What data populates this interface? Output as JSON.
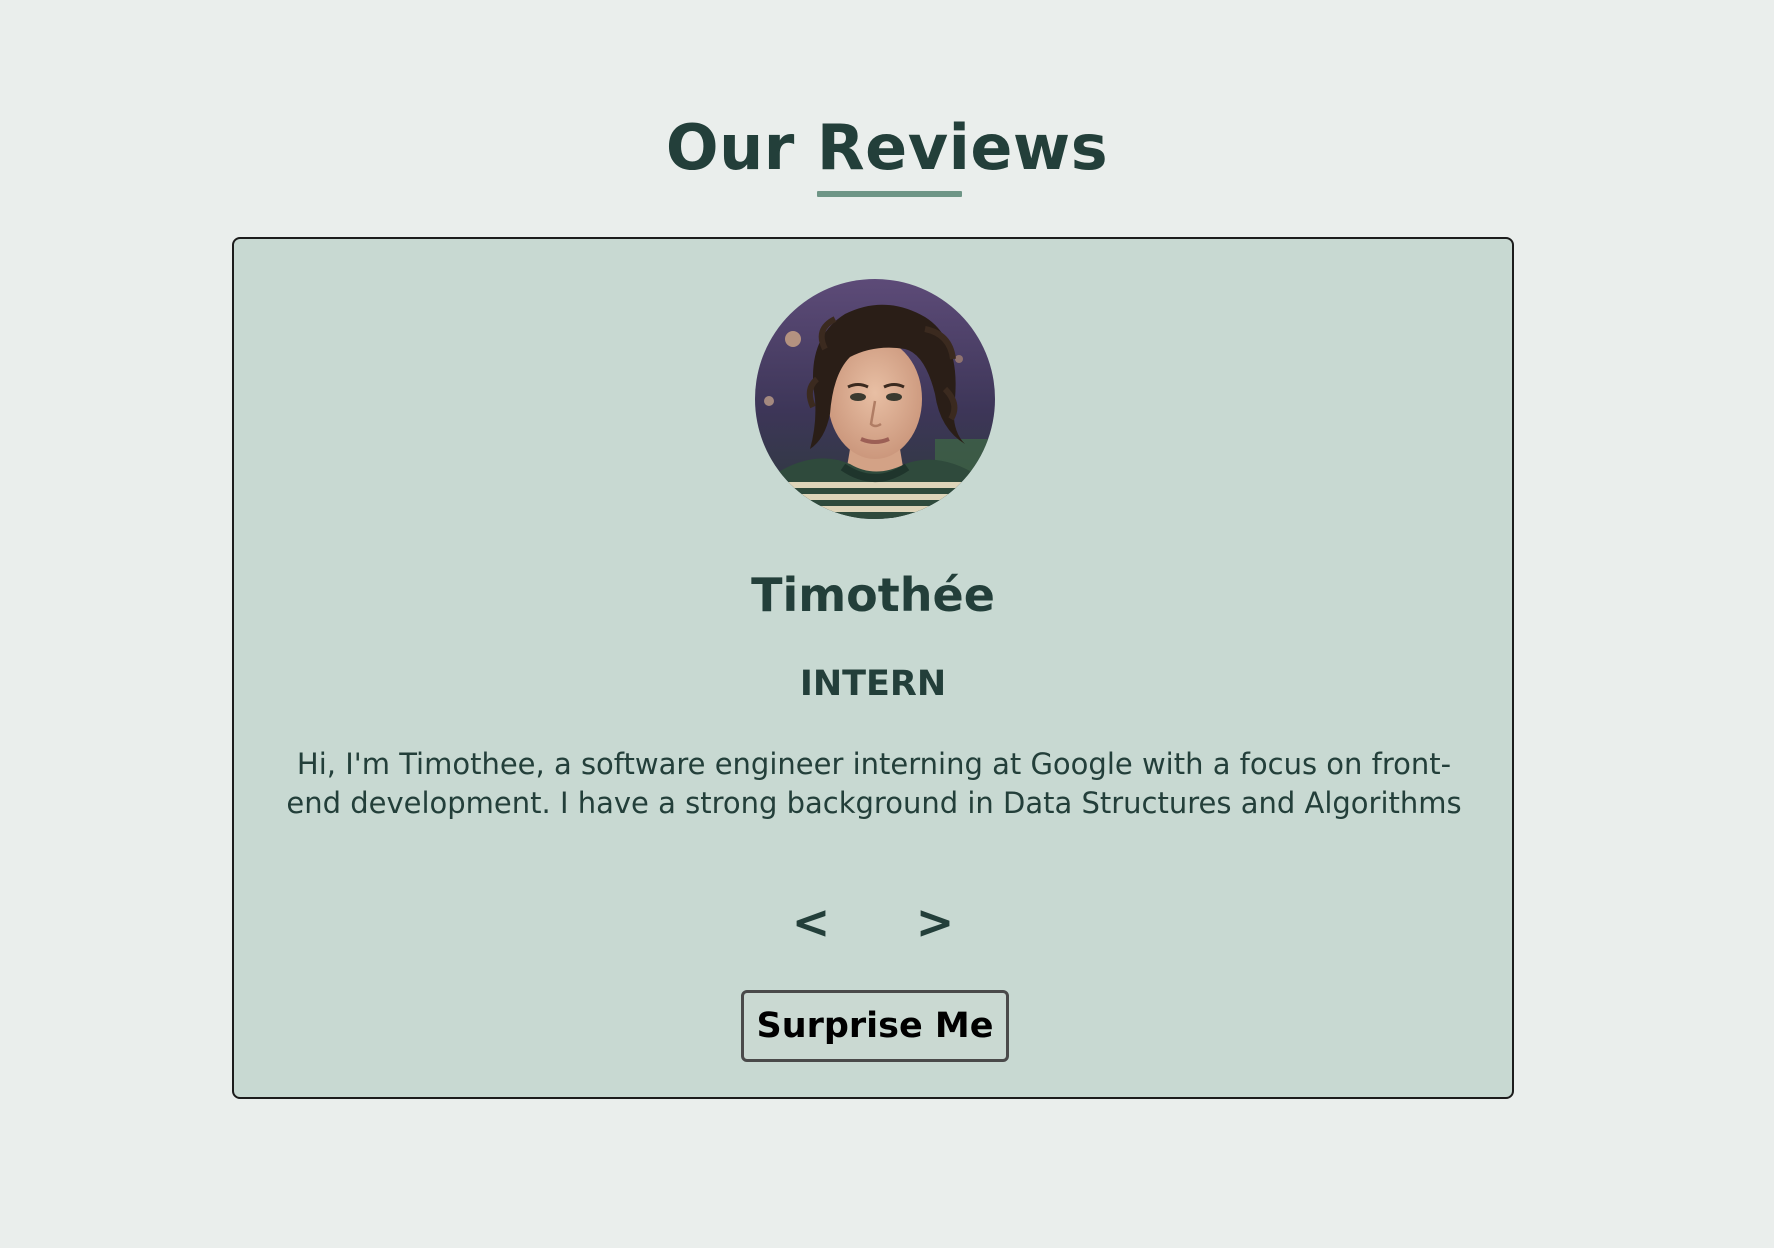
{
  "header": {
    "title_first": "Our",
    "title_accent": "Reviews"
  },
  "review": {
    "name": "Timothée",
    "role": "INTERN",
    "text": "Hi, I'm Timothee, a software engineer interning at Google with a focus on front-end development. I have a strong background in Data Structures and Algorithms",
    "avatar_alt": "Timothée"
  },
  "nav": {
    "prev_label": "<",
    "next_label": ">"
  },
  "actions": {
    "surprise_label": "Surprise Me"
  },
  "colors": {
    "page_background": "#eaeeec",
    "card_background": "#c8d9d2",
    "text_dark_green": "#233f3a",
    "accent_underline": "#6e9586",
    "card_border": "#1c1c1c"
  }
}
